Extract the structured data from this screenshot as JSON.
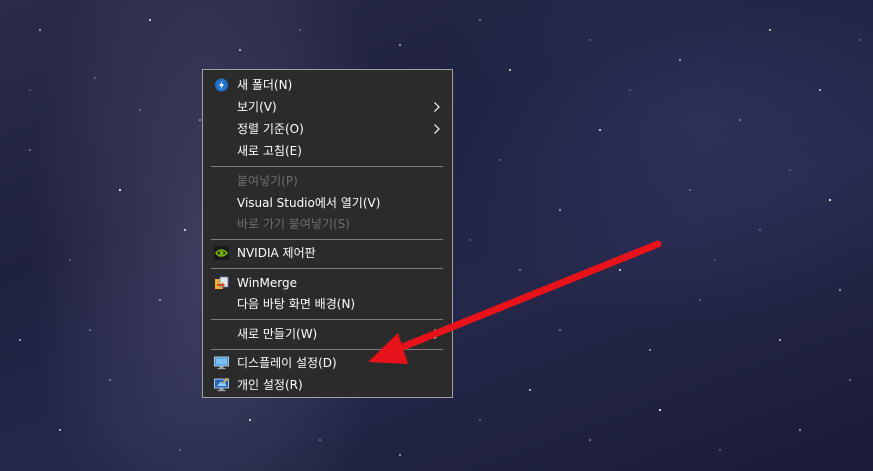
{
  "context_menu": {
    "items": [
      {
        "label": "새 폴더(N)",
        "icon": "new-folder-icon",
        "enabled": true
      },
      {
        "label": "보기(V)",
        "submenu": true,
        "enabled": true
      },
      {
        "label": "정렬 기준(O)",
        "submenu": true,
        "enabled": true
      },
      {
        "label": "새로 고침(E)",
        "enabled": true
      },
      {
        "label": "붙여넣기(P)",
        "enabled": false
      },
      {
        "label": "Visual Studio에서 열기(V)",
        "enabled": true
      },
      {
        "label": "바로 가기 붙여넣기(S)",
        "enabled": false
      },
      {
        "label": "NVIDIA 제어판",
        "icon": "nvidia-icon",
        "enabled": true
      },
      {
        "label": "WinMerge",
        "icon": "winmerge-icon",
        "enabled": true
      },
      {
        "label": "다음 바탕 화면 배경(N)",
        "enabled": true
      },
      {
        "label": "새로 만들기(W)",
        "submenu": true,
        "enabled": true
      },
      {
        "label": "디스플레이 설정(D)",
        "icon": "display-settings-icon",
        "enabled": true
      },
      {
        "label": "개인 설정(R)",
        "icon": "personalize-icon",
        "enabled": true
      }
    ]
  },
  "colors": {
    "menu_background": "#2b2b2b",
    "menu_text": "#ffffff",
    "disabled_text": "#6d6d6d",
    "arrow": "#e8121a"
  }
}
